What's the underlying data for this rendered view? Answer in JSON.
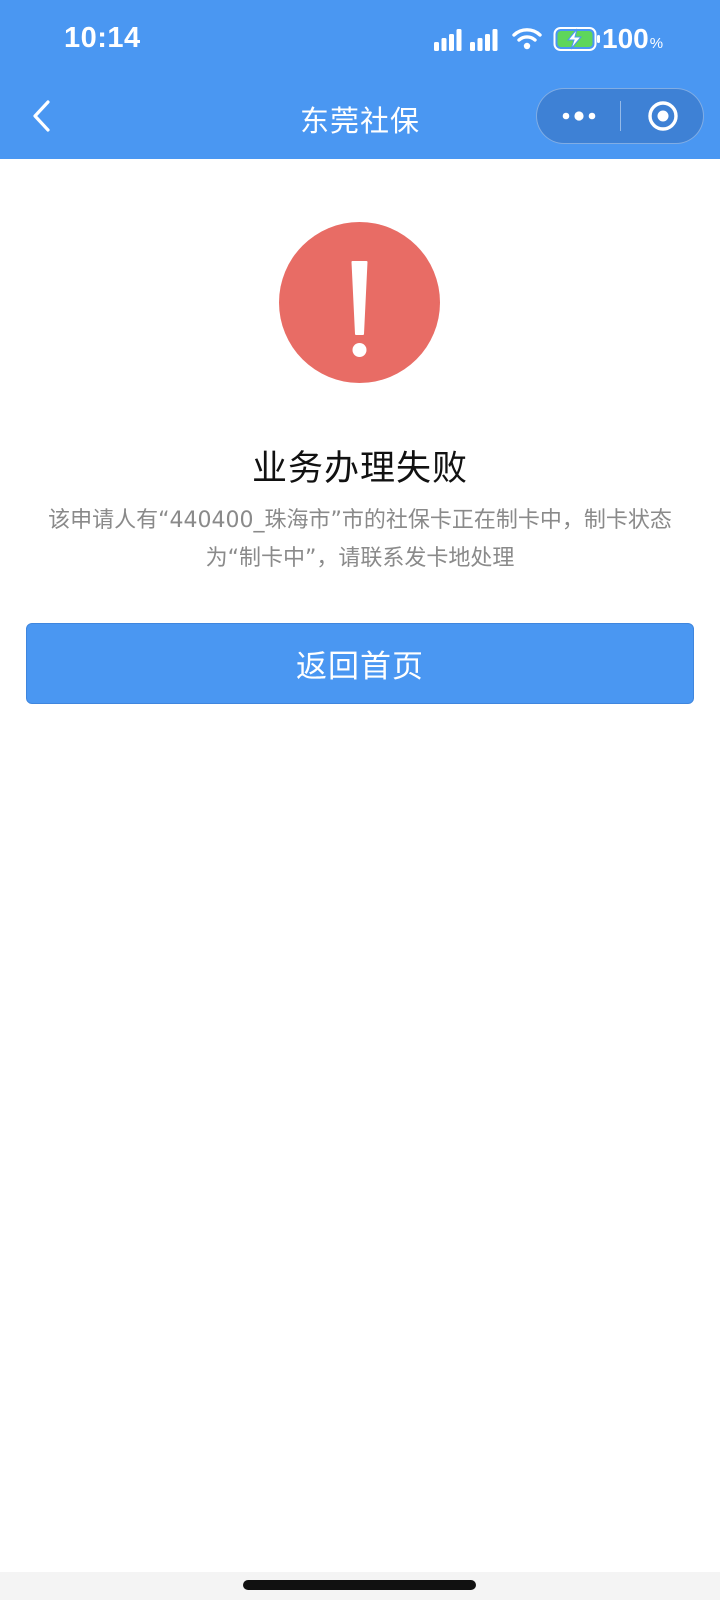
{
  "status_bar": {
    "time": "10:14",
    "battery_percent": "100",
    "battery_percent_sign": "%",
    "icons": [
      "signal-icon",
      "wifi-icon",
      "battery-charging-icon"
    ]
  },
  "nav": {
    "title": "东莞社保",
    "icons": [
      "back-chevron-icon",
      "more-dots-icon",
      "close-target-icon"
    ]
  },
  "result": {
    "status": "error",
    "icon": "exclamation-icon",
    "title": "业务办理失败",
    "description": "该申请人有“440400_珠海市”市的社保卡正在制卡中，制卡状态为“制卡中”，请联系发卡地处理"
  },
  "actions": {
    "home_label": "返回首页"
  },
  "colors": {
    "header_blue": "#4a97f2",
    "error_red": "#e86c65",
    "description_gray": "#8a8a8a"
  }
}
